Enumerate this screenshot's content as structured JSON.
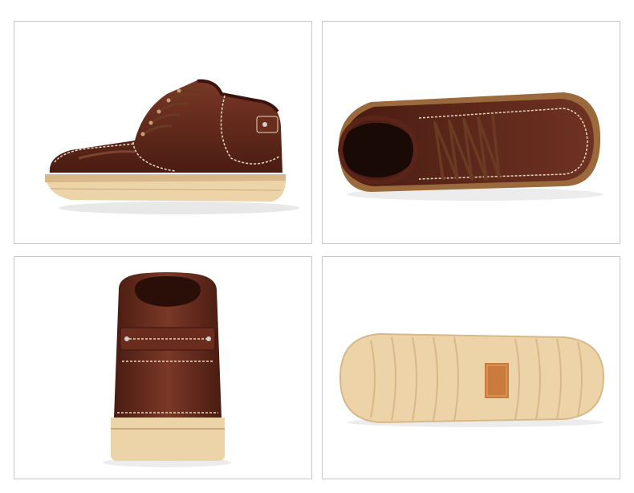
{
  "gallery": {
    "views": [
      {
        "view": "side",
        "color": "#5a2418"
      },
      {
        "view": "top",
        "color": "#5a2418"
      },
      {
        "view": "back",
        "color": "#5a2418"
      },
      {
        "view": "sole",
        "color": "#ecd3a8"
      }
    ]
  },
  "colors": {
    "leather": "#5a2418",
    "leather_highlight": "#8b4a35",
    "stitch": "#e8d8c0",
    "lace": "#6a3a22",
    "sole": "#ecd3a8",
    "sole_dark": "#d8b888",
    "label": "#c97a3c"
  }
}
